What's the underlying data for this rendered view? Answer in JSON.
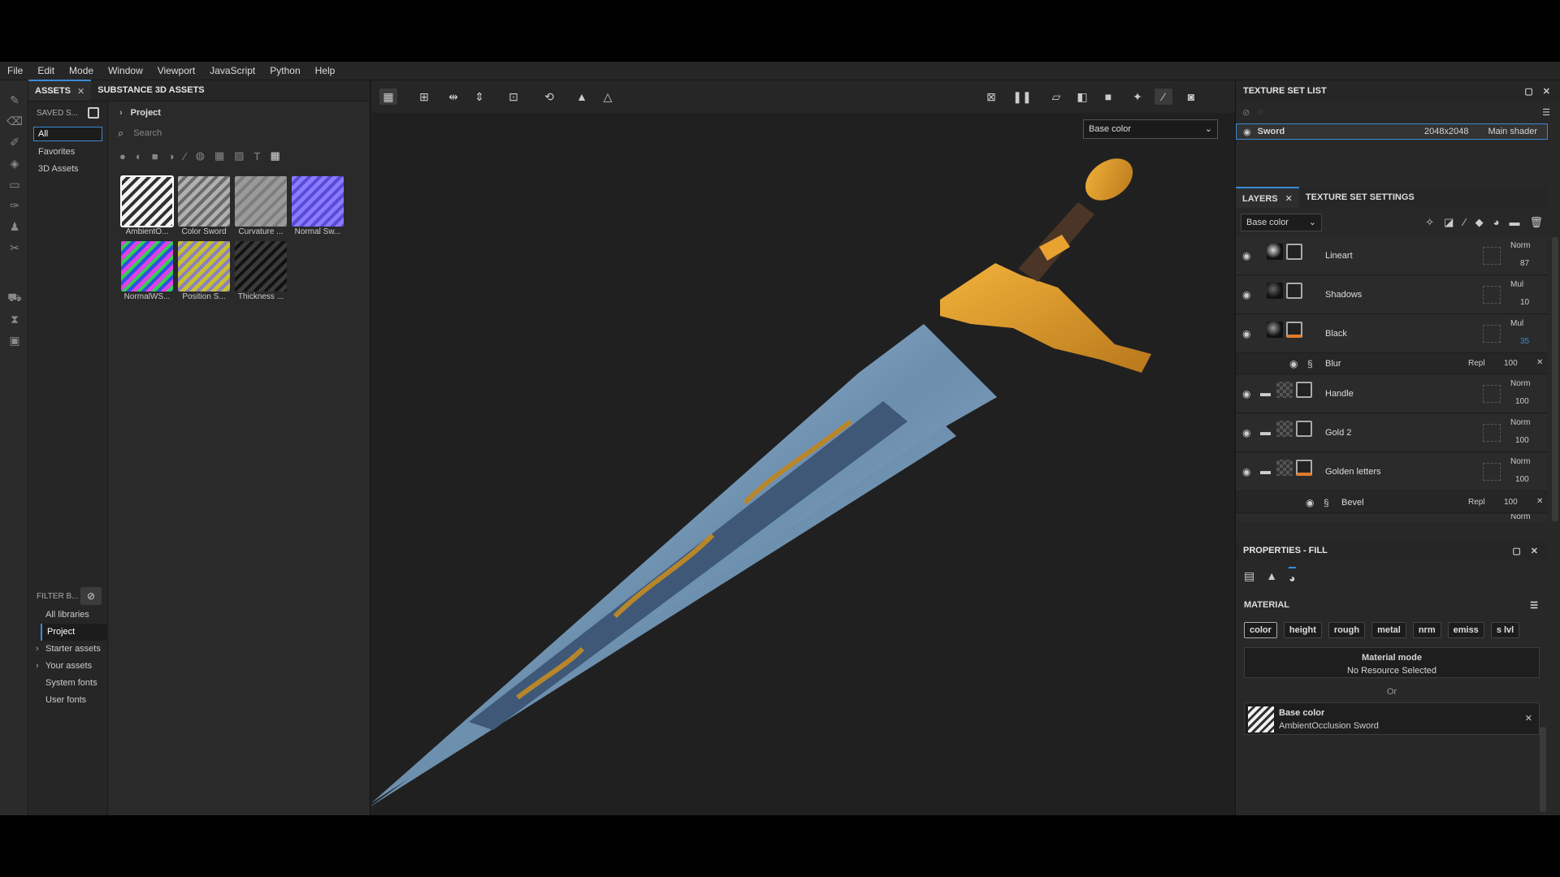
{
  "menu": [
    "File",
    "Edit",
    "Mode",
    "Window",
    "Viewport",
    "JavaScript",
    "Python",
    "Help"
  ],
  "assets_panel": {
    "tabs": [
      {
        "label": "ASSETS",
        "close": "✕"
      },
      {
        "label": "SUBSTANCE 3D ASSETS"
      }
    ],
    "saved_label": "SAVED S...",
    "filter_selected": "All",
    "shelf_items": [
      "Favorites",
      "3D Assets"
    ],
    "breadcrumb": "Project",
    "search_placeholder": "Search",
    "thumbnails": [
      {
        "label": "AmbientO...",
        "color": "#e8e8e8",
        "selected": true
      },
      {
        "label": "Color Sword",
        "color": "#9a9a9a"
      },
      {
        "label": "Curvature ...",
        "color": "#8a8a8a"
      },
      {
        "label": "Normal Sw...",
        "color": "#7a6cff"
      },
      {
        "label": "NormalWS...",
        "color": "#c43ad8"
      },
      {
        "label": "Position S...",
        "color": "#b8b030"
      },
      {
        "label": "Thickness ...",
        "color": "#2e2e2e"
      }
    ],
    "filter_label": "FILTER B...",
    "libraries": [
      {
        "label": "All libraries"
      },
      {
        "label": "Project",
        "selected": true
      },
      {
        "label": "Starter assets",
        "expandable": true
      },
      {
        "label": "Your assets",
        "expandable": true
      },
      {
        "label": "System fonts"
      },
      {
        "label": "User fonts"
      }
    ]
  },
  "viewport": {
    "channel": "Base color"
  },
  "texture_set_list": {
    "title": "TEXTURE SET LIST",
    "set": {
      "name": "Sword",
      "resolution": "2048x2048",
      "shader": "Main shader"
    }
  },
  "layers_panel": {
    "tabs": [
      {
        "label": "LAYERS"
      },
      {
        "label": "TEXTURE SET SETTINGS"
      }
    ],
    "channel": "Base color",
    "layers": [
      {
        "name": "Lineart",
        "mode": "Norm",
        "opacity": "87"
      },
      {
        "name": "Shadows",
        "mode": "Mul",
        "opacity": "10"
      },
      {
        "name": "Black",
        "mode": "Mul",
        "opacity": "35"
      },
      {
        "name": "Handle",
        "mode": "Norm",
        "opacity": "100"
      },
      {
        "name": "Gold 2",
        "mode": "Norm",
        "opacity": "100"
      },
      {
        "name": "Golden letters",
        "mode": "Norm",
        "opacity": "100"
      }
    ],
    "effects": [
      {
        "name": "Blur",
        "mode": "Repl",
        "opacity": "100"
      },
      {
        "name": "Bevel",
        "mode": "Repl",
        "opacity": "100"
      }
    ],
    "partial_mode": "Norm"
  },
  "properties": {
    "title": "PROPERTIES - FILL",
    "material_label": "MATERIAL",
    "channels": [
      "color",
      "height",
      "rough",
      "metal",
      "nrm",
      "emiss",
      "s lvl"
    ],
    "material_mode_label": "Material mode",
    "material_mode_value": "No Resource Selected",
    "or_label": "Or",
    "resource_title": "Base color",
    "resource_name": "AmbientOcclusion Sword"
  },
  "colors": {
    "accent": "#3a8bd6",
    "orange": "#e07a2a",
    "bg": "#222222"
  }
}
